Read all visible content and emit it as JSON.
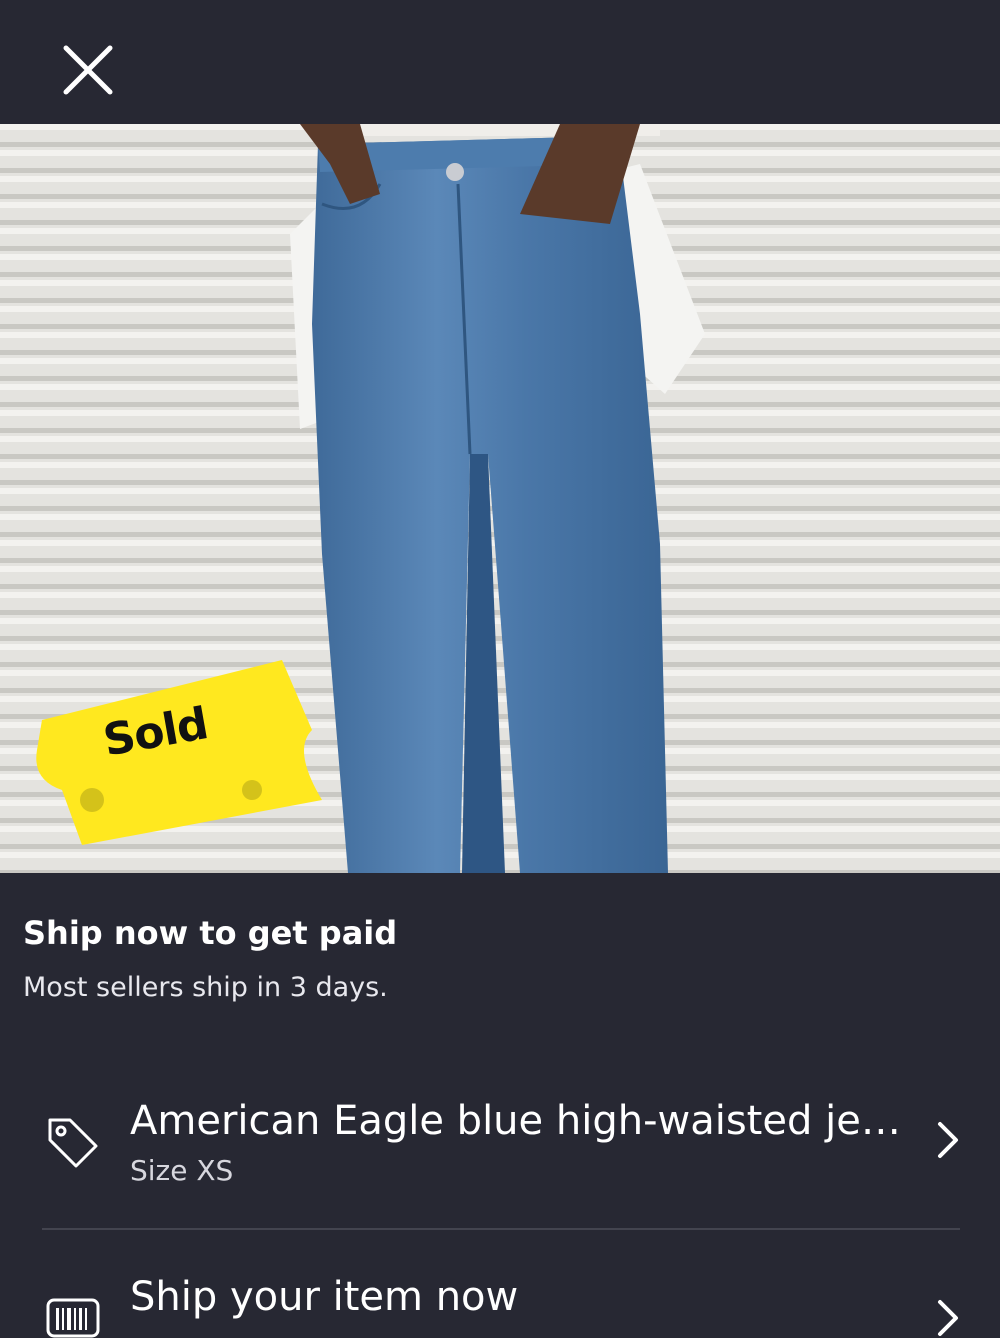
{
  "header": {
    "close_icon": "close-icon"
  },
  "listing_photo": {
    "sold_badge": "Sold",
    "badge_color": "#FFE81F"
  },
  "shipping_prompt": {
    "title": "Ship now to get paid",
    "subtitle": "Most sellers ship in 3 days."
  },
  "rows": [
    {
      "icon": "tag-icon",
      "title": "American Eagle blue high-waisted jeans",
      "subtitle": "Size XS"
    },
    {
      "icon": "barcode-icon",
      "title": "Ship your item now"
    }
  ],
  "colors": {
    "background": "#272833",
    "text": "#FFFFFF",
    "divider": "#43444F"
  }
}
